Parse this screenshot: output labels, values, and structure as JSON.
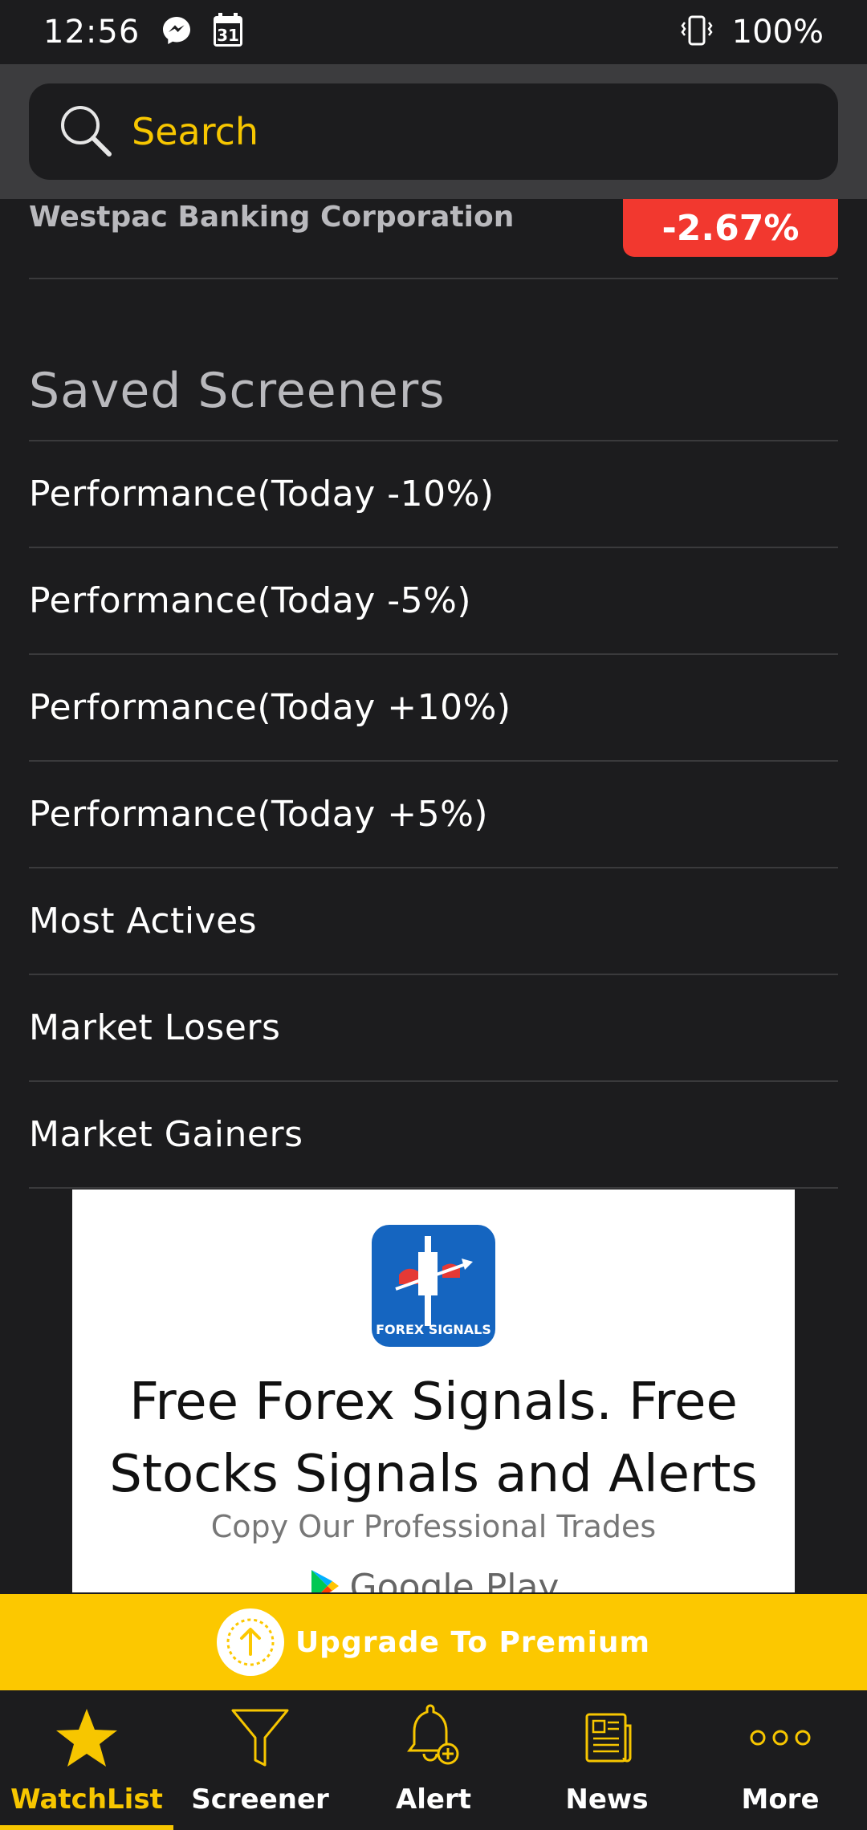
{
  "status_bar": {
    "time": "12:56",
    "battery": "100%",
    "icons": [
      "messenger-icon",
      "calendar-icon",
      "vibrate-icon"
    ],
    "calendar_day": "31"
  },
  "search": {
    "placeholder": "Search",
    "icon": "search-icon"
  },
  "watchlist_row": {
    "name": "Westpac Banking Corporation",
    "change": "-2.67%",
    "change_color": "#f2382f"
  },
  "saved_screeners": {
    "title": "Saved Screeners",
    "items": [
      {
        "label": "Performance(Today -10%)"
      },
      {
        "label": "Performance(Today -5%)"
      },
      {
        "label": "Performance(Today +10%)"
      },
      {
        "label": "Performance(Today +5%)"
      },
      {
        "label": "Most Actives"
      },
      {
        "label": "Market Losers"
      },
      {
        "label": "Market Gainers"
      }
    ]
  },
  "ad": {
    "logo_label": "FOREX SIGNALS",
    "title": "Free Forex Signals. Free Stocks Signals and Alerts",
    "subtitle": "Copy Our Professional Trades",
    "store": "Google Play"
  },
  "upgrade": {
    "label": "Upgrade To Premium"
  },
  "bottom_nav": {
    "accent": "#f7c600",
    "items": [
      {
        "label": "WatchList",
        "icon": "star-icon",
        "active": true
      },
      {
        "label": "Screener",
        "icon": "funnel-icon",
        "active": false
      },
      {
        "label": "Alert",
        "icon": "bell-plus-icon",
        "active": false
      },
      {
        "label": "News",
        "icon": "newspaper-icon",
        "active": false
      },
      {
        "label": "More",
        "icon": "more-dots-icon",
        "active": false
      }
    ]
  }
}
